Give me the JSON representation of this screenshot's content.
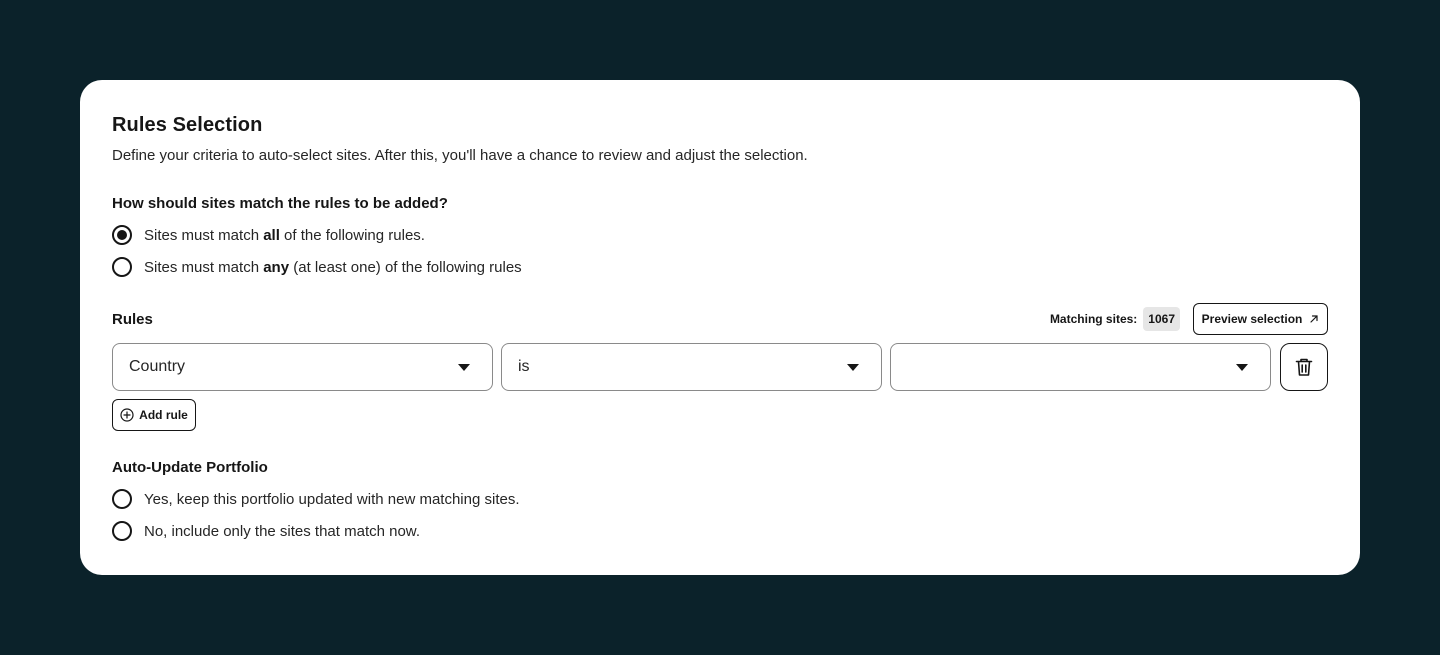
{
  "header": {
    "title": "Rules Selection",
    "subtitle": "Define your criteria to auto-select sites. After this, you'll have a chance to review and adjust the selection."
  },
  "match_mode": {
    "question": "How should sites match the rules to be added?",
    "options": [
      {
        "prefix": "Sites must match ",
        "emphasis": "all",
        "suffix": " of the following rules.",
        "selected": true
      },
      {
        "prefix": "Sites must match ",
        "emphasis": "any",
        "suffix": " (at least one) of the following rules",
        "selected": false
      }
    ]
  },
  "rules": {
    "label": "Rules",
    "matching_label": "Matching sites:",
    "matching_count": "1067",
    "preview_label": "Preview selection",
    "preview_icon": "arrow-up-right-icon",
    "rows": [
      {
        "field": "Country",
        "operator": "is",
        "value": ""
      }
    ],
    "delete_icon": "trash-icon",
    "add_rule_label": "Add rule",
    "add_rule_icon": "plus-circle-icon"
  },
  "auto_update": {
    "label": "Auto-Update Portfolio",
    "options": [
      {
        "text": "Yes, keep this portfolio updated with new matching sites.",
        "selected": false
      },
      {
        "text": "No, include only the sites that match now.",
        "selected": false
      }
    ]
  },
  "colors": {
    "background": "#0b222a",
    "card": "#ffffff",
    "text": "#161616",
    "badge": "#e6e6e6"
  }
}
